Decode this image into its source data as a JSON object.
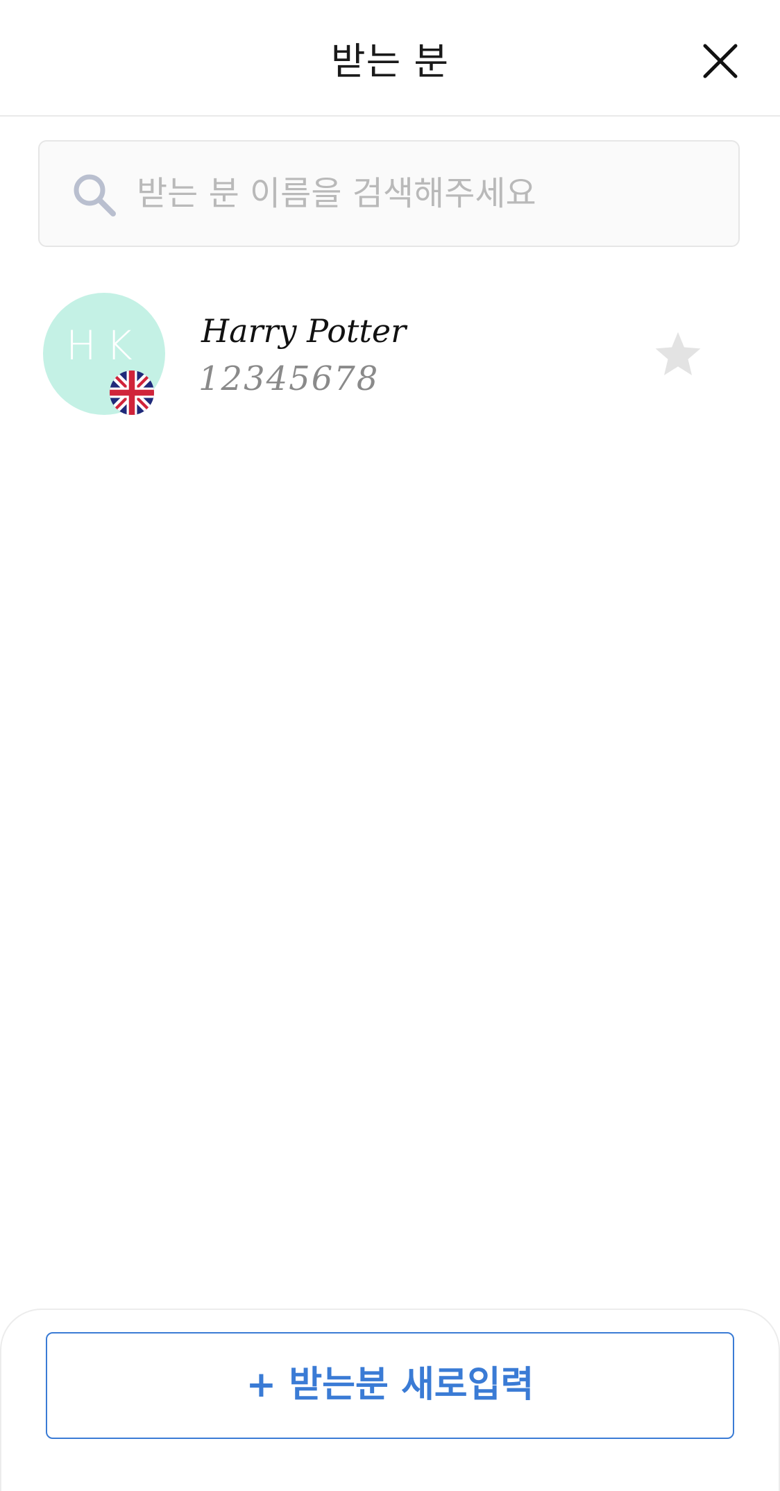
{
  "header": {
    "title": "받는 분",
    "close_icon": "close-icon"
  },
  "search": {
    "placeholder": "받는 분 이름을 검색해주세요",
    "value": "",
    "icon": "search-icon"
  },
  "recipients": [
    {
      "initials": "HK",
      "name": "Harry Potter",
      "number": "12345678",
      "flag_icon": "uk-flag-icon",
      "favorite": false,
      "avatar_color": "#c4f1e5"
    }
  ],
  "bottom": {
    "new_recipient_label": "+ 받는분 새로입력"
  },
  "colors": {
    "accent": "#3a7bd5",
    "star_inactive": "#e3e3e3",
    "search_icon": "#b9bfcf"
  }
}
